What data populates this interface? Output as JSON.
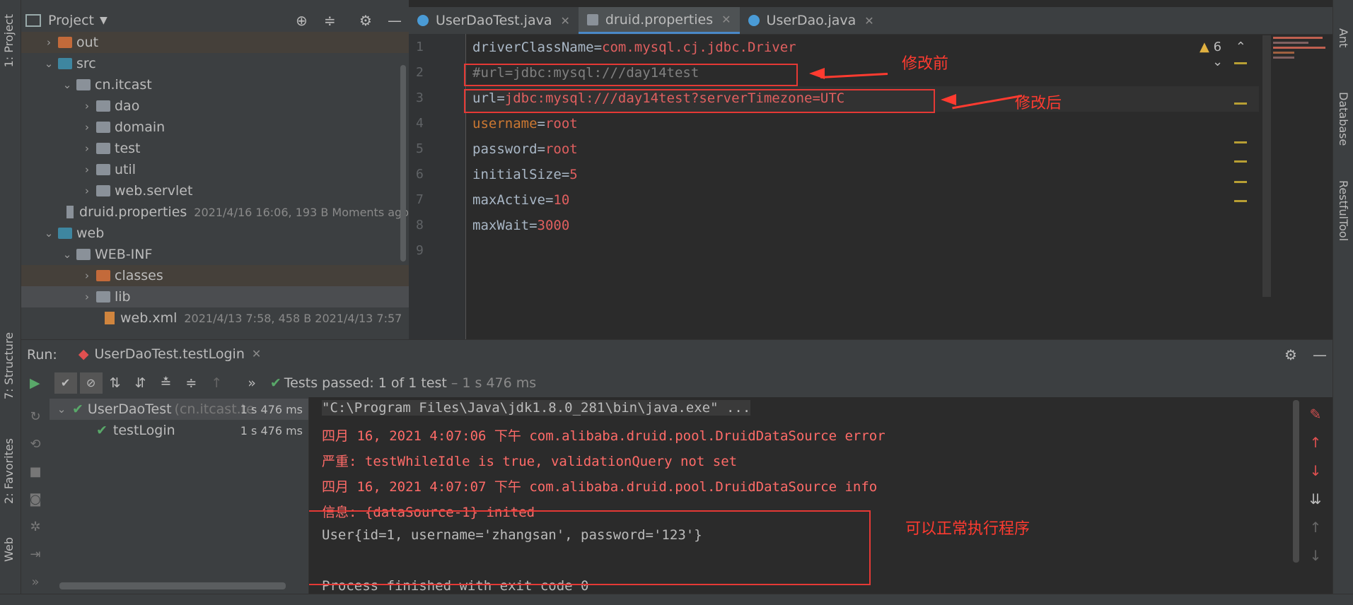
{
  "left_strip": {
    "project_tab": "1: Project",
    "structure_tab": "7: Structure",
    "favorites_tab": "2: Favorites",
    "web_tab": "Web"
  },
  "right_strip": {
    "ant_tab": "Ant",
    "database_tab": "Database",
    "restful_tab": "RestfulTool"
  },
  "project": {
    "header": "Project",
    "items": [
      {
        "label": "out",
        "meta": ""
      },
      {
        "label": "src",
        "meta": ""
      },
      {
        "label": "cn.itcast",
        "meta": ""
      },
      {
        "label": "dao",
        "meta": ""
      },
      {
        "label": "domain",
        "meta": ""
      },
      {
        "label": "test",
        "meta": ""
      },
      {
        "label": "util",
        "meta": ""
      },
      {
        "label": "web.servlet",
        "meta": ""
      },
      {
        "label": "druid.properties",
        "meta": "2021/4/16 16:06, 193 B Moments ago"
      },
      {
        "label": "web",
        "meta": ""
      },
      {
        "label": "WEB-INF",
        "meta": ""
      },
      {
        "label": "classes",
        "meta": ""
      },
      {
        "label": "lib",
        "meta": ""
      },
      {
        "label": "web.xml",
        "meta": "2021/4/13 7:58, 458 B 2021/4/13 7:57"
      }
    ]
  },
  "tabs": [
    {
      "label": "UserDaoTest.java"
    },
    {
      "label": "druid.properties"
    },
    {
      "label": "UserDao.java"
    }
  ],
  "editor": {
    "line_numbers": [
      "1",
      "2",
      "3",
      "4",
      "5",
      "6",
      "7",
      "8",
      "9"
    ],
    "lines": [
      {
        "key": "driverClassName",
        "eq": "=",
        "value": "com.mysql.cj.jdbc.Driver"
      },
      {
        "comment": "#url=jdbc:mysql:///day14test"
      },
      {
        "key": "url",
        "eq": "=",
        "value": "jdbc:mysql:///day14test?serverTimezone=UTC"
      },
      {
        "key": "username",
        "eq": "=",
        "value": "root"
      },
      {
        "key": "password",
        "eq": "=",
        "value": "root"
      },
      {
        "key": "initialSize",
        "eq": "=",
        "value": "5"
      },
      {
        "key": "maxActive",
        "eq": "=",
        "value": "10"
      },
      {
        "key": "maxWait",
        "eq": "=",
        "value": "3000"
      }
    ],
    "warnings": "6",
    "annotation_before": "修改前",
    "annotation_after": "修改后"
  },
  "run": {
    "label": "Run:",
    "tab": "UserDaoTest.testLogin",
    "status_prefix": "Tests passed:",
    "status_count": "1",
    "status_suffix": "of 1 test",
    "status_time": "– 1 s 476 ms",
    "tree": [
      {
        "label": "UserDaoTest",
        "pkg": "(cn.itcast.te",
        "time": "1 s 476 ms"
      },
      {
        "label": "testLogin",
        "pkg": "",
        "time": "1 s 476 ms"
      }
    ],
    "console": [
      "\"C:\\Program Files\\Java\\jdk1.8.0_281\\bin\\java.exe\" ...",
      "四月 16, 2021 4:07:06 下午 com.alibaba.druid.pool.DruidDataSource error",
      "严重: testWhileIdle is true, validationQuery not set",
      "四月 16, 2021 4:07:07 下午 com.alibaba.druid.pool.DruidDataSource info",
      "信息: {dataSource-1} inited",
      "User{id=1, username='zhangsan', password='123'}",
      "",
      "Process finished with exit code 0"
    ],
    "annotation_ok": "可以正常执行程序"
  }
}
